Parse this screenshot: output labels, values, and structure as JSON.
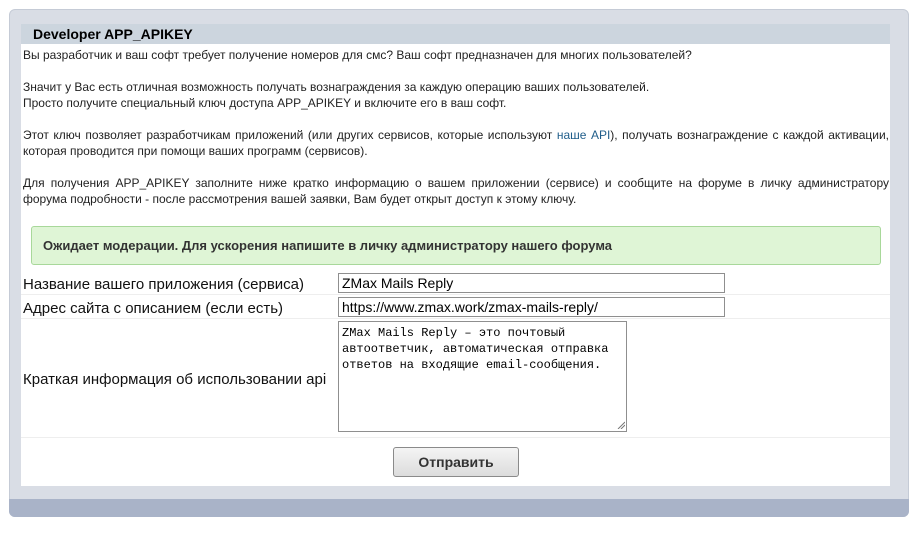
{
  "header": {
    "title": "Developer APP_APIKEY"
  },
  "intro": {
    "p1": "Вы разработчик и ваш софт требует получение номеров для смс? Ваш софт предназначен для многих пользователей?",
    "p2_line1": "Значит у Вас есть отличная возможность получать вознаграждения за каждую операцию ваших пользователей.",
    "p2_line2": "Просто получите специальный ключ доступа APP_APIKEY и включите его в ваш софт.",
    "p3_before": "Этот ключ позволяет разработчикам приложений (или других сервисов, которые используют ",
    "p3_link": "наше API",
    "p3_after": "), получать вознаграждение с каждой активации, которая проводится при помощи ваших программ (сервисов).",
    "p4": "Для получения APP_APIKEY заполните ниже кратко информацию о вашем приложении (сервисе) и сообщите на форуме в личку администратору форума подробности - после рассмотрения вашей заявки, Вам будет открыт доступ к этому ключу."
  },
  "notice": {
    "text": "Ожидает модерации. Для ускорения напишите в личку администратору нашего форума"
  },
  "form": {
    "app_name_label": "Название вашего приложения (сервиса)",
    "app_name_value": "ZMax Mails Reply",
    "site_label": "Адрес сайта с описанием (если есть)",
    "site_value": "https://www.zmax.work/zmax-mails-reply/",
    "info_label": "Краткая информация об использовании api",
    "info_value": "ZMax Mails Reply – это почтовый автоответчик, автоматическая отправка ответов на входящие email-сообщения.",
    "submit_label": "Отправить"
  },
  "colors": {
    "panel_bg": "#d9dde5",
    "header_bg": "#ccd5de",
    "footer_bar": "#a9b3c8",
    "notice_bg": "#dff5d6",
    "notice_border": "#a8d89a",
    "link": "#1f5d8a"
  },
  "icons": {
    "resize_handle": "resize-grip-icon"
  }
}
